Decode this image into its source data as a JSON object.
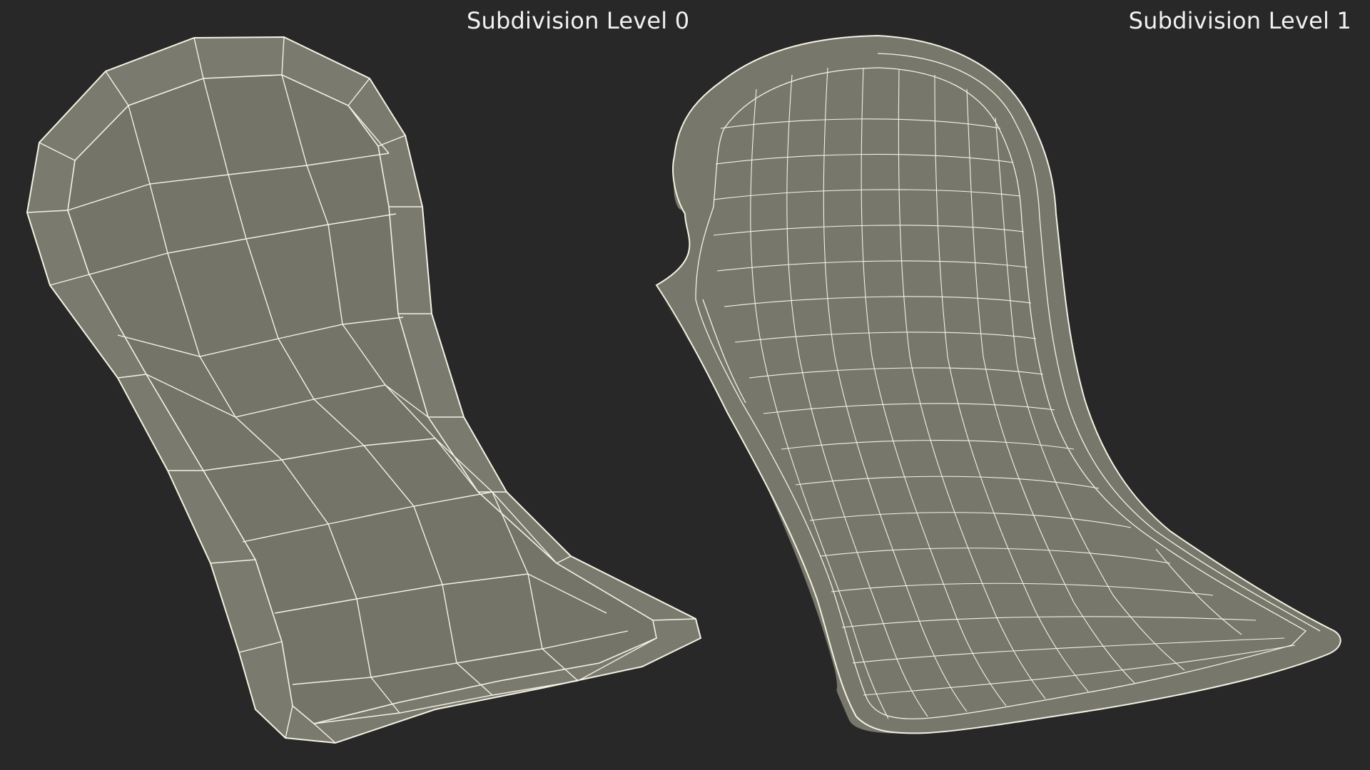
{
  "views": [
    {
      "label": "Subdivision Level 0"
    },
    {
      "label": "Subdivision Level 1"
    }
  ],
  "colors": {
    "background": "#282828",
    "surface": "#7a7a6e",
    "surface_dark": "#6f6f64",
    "wire": "#f4f2e2",
    "label": "#f2f2f2"
  }
}
